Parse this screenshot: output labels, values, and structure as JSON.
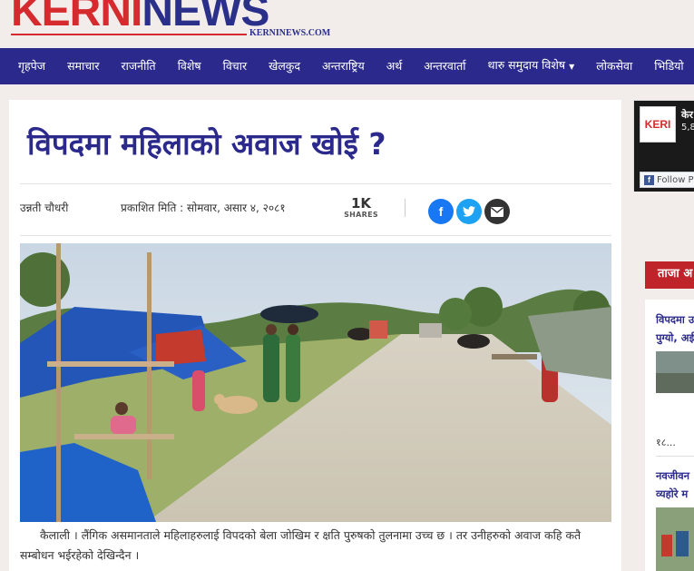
{
  "site": {
    "logo_part1": "KERNI",
    "logo_part2": "NEWS",
    "domain": "KERNINEWS.COM"
  },
  "nav": {
    "items": [
      {
        "label": "गृहपेज"
      },
      {
        "label": "समाचार"
      },
      {
        "label": "राजनीति"
      },
      {
        "label": "विशेष"
      },
      {
        "label": "विचार"
      },
      {
        "label": "खेलकुद"
      },
      {
        "label": "अन्तराष्ट्रिय"
      },
      {
        "label": "अर्थ"
      },
      {
        "label": "अन्तरवार्ता"
      },
      {
        "label": "थारु समुदाय विशेष",
        "has_dropdown": true
      },
      {
        "label": "लोकसेवा"
      },
      {
        "label": "भिडियो"
      }
    ]
  },
  "article": {
    "title": "विपदमा महिलाको अवाज खोई ?",
    "author": "उन्नती चौधरी",
    "published": "प्रकाशित मिति : सोमवार, असार ४, २०८१",
    "shares_count": "1K",
    "shares_label": "SHARES",
    "share_buttons": {
      "facebook": "f",
      "twitter": "t",
      "email": "✉"
    },
    "lead": "कैलाली । लैंगिक असमानताले महिलाहरुलाई विपदको बेला जोखिम र क्षति पुरुषको तुलनामा उच्च छ । तर उनीहरुको अवाज कहि कतै सम्बोधन भईरहेको देखिन्दैन ।"
  },
  "sidebar": {
    "fb_widget": {
      "logo": "KERI",
      "name": "केर",
      "count": "5,8",
      "follow_label": "Follow P"
    },
    "latest": {
      "heading": "ताजा अ",
      "items": [
        {
          "title_line1": "विपदमा उ",
          "title_line2": "पुग्यो, अई",
          "date": "१८..."
        },
        {
          "title_line1": "नवजीवन",
          "title_line2": "व्यहोरे म"
        }
      ]
    }
  },
  "colors": {
    "brand_red": "#d52b2f",
    "brand_blue": "#2b2a8c",
    "nav_bg": "#2b2a8c",
    "facebook": "#1877f2",
    "twitter": "#1da1f2",
    "latest_heading": "#c0242b"
  }
}
